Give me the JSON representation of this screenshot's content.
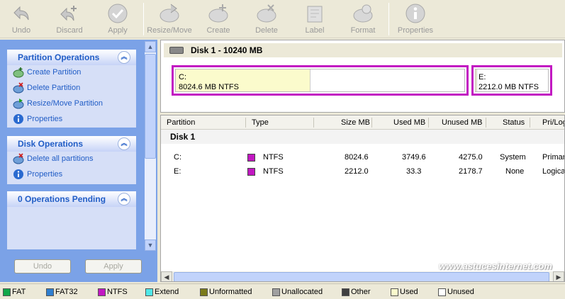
{
  "toolbar": {
    "buttons": [
      {
        "label": "Undo",
        "icon": "undo-arrow-icon"
      },
      {
        "label": "Discard",
        "icon": "discard-icon"
      },
      {
        "label": "Apply",
        "icon": "apply-check-icon"
      },
      {
        "label": "Resize/Move",
        "icon": "resize-move-icon"
      },
      {
        "label": "Create",
        "icon": "create-partition-icon"
      },
      {
        "label": "Delete",
        "icon": "delete-partition-icon"
      },
      {
        "label": "Label",
        "icon": "label-icon"
      },
      {
        "label": "Format",
        "icon": "format-icon"
      },
      {
        "label": "Properties",
        "icon": "info-icon"
      }
    ]
  },
  "left_pane": {
    "partition_operations": {
      "title": "Partition Operations",
      "items": [
        {
          "label": "Create Partition",
          "icon": "create-partition-icon"
        },
        {
          "label": "Delete Partition",
          "icon": "delete-partition-icon"
        },
        {
          "label": "Resize/Move Partition",
          "icon": "resize-move-icon"
        },
        {
          "label": "Properties",
          "icon": "info-icon"
        }
      ]
    },
    "disk_operations": {
      "title": "Disk Operations",
      "items": [
        {
          "label": "Delete all partitions",
          "icon": "delete-all-icon"
        },
        {
          "label": "Properties",
          "icon": "info-icon"
        }
      ]
    },
    "pending": {
      "title": "0 Operations Pending"
    },
    "undo_label": "Undo",
    "apply_label": "Apply"
  },
  "disk_map": {
    "title": "Disk 1 - 10240 MB",
    "partitions": [
      {
        "name": "C:",
        "details": "8024.6 MB  NTFS",
        "used_fraction": 0.467
      },
      {
        "name": "E:",
        "details": "2212.0 MB  NTFS",
        "used_fraction": 0.015
      }
    ]
  },
  "partition_list": {
    "columns": [
      "Partition",
      "Type",
      "Size MB",
      "Used MB",
      "Unused MB",
      "Status",
      "Pri/Log"
    ],
    "group": "Disk 1",
    "rows": [
      {
        "partition": "C:",
        "type": "NTFS",
        "size": "8024.6",
        "used": "3749.6",
        "unused": "4275.0",
        "status": "System",
        "prilog": "Primary"
      },
      {
        "partition": "E:",
        "type": "NTFS",
        "size": "2212.0",
        "used": "33.3",
        "unused": "2178.7",
        "status": "None",
        "prilog": "Logical"
      }
    ]
  },
  "watermark": "www.astucesinternet.com",
  "legend": [
    {
      "label": "FAT",
      "color": "#12a84a"
    },
    {
      "label": "FAT32",
      "color": "#2f7fd0"
    },
    {
      "label": "NTFS",
      "color": "#c218c2"
    },
    {
      "label": "Extend",
      "color": "#4fe8e8"
    },
    {
      "label": "Unformatted",
      "color": "#7b7b1a"
    },
    {
      "label": "Unallocated",
      "color": "#a0a0a0"
    },
    {
      "label": "Other",
      "color": "#404040"
    },
    {
      "label": "Used",
      "color": "#fbfbcc"
    },
    {
      "label": "Unused",
      "color": "#ffffff"
    }
  ],
  "colors": {
    "ntfs": "#c218c2",
    "task_link": "#215dc6",
    "pane_bg": "#7ba2e7"
  }
}
